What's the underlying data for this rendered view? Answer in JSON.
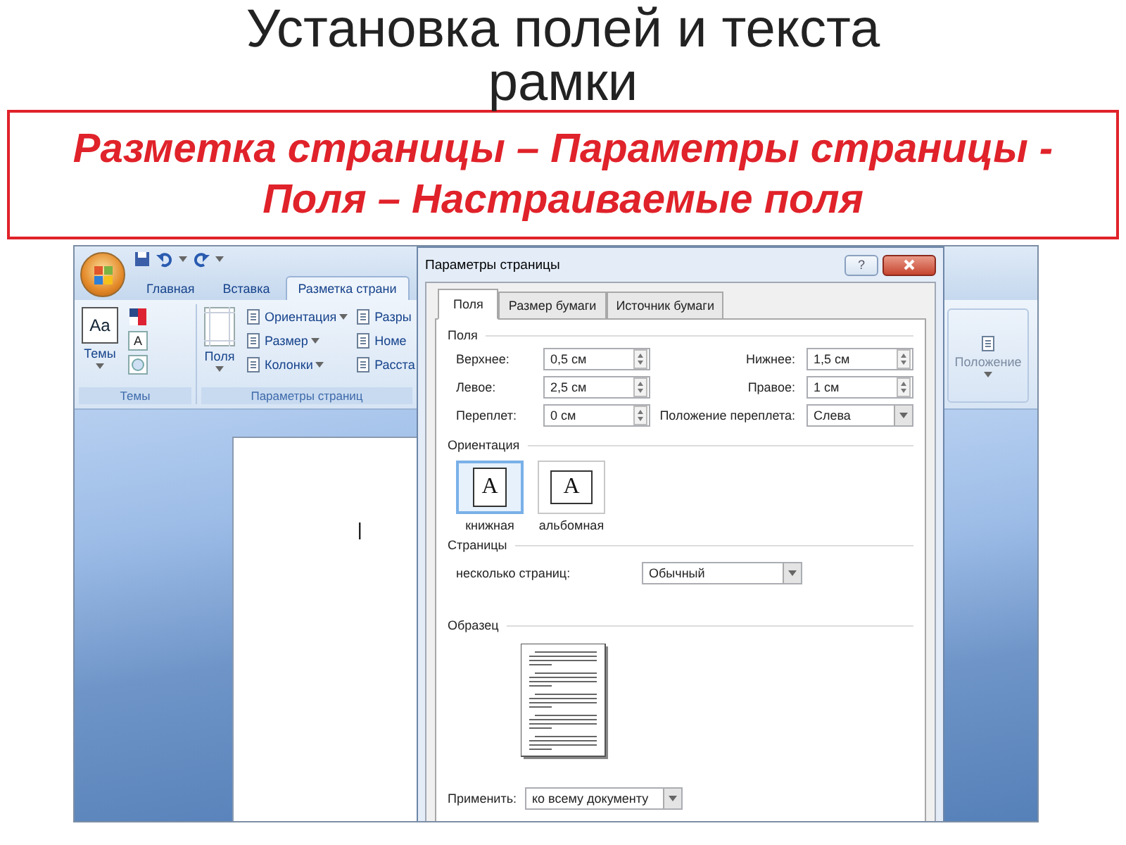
{
  "slide": {
    "title": "Установка полей и текста рамки",
    "callout": "Разметка страницы – Параметры страницы - Поля – Настраиваемые поля"
  },
  "word": {
    "tabs": [
      {
        "label": "Главная",
        "selected": false
      },
      {
        "label": "Вставка",
        "selected": false
      },
      {
        "label": "Разметка страни",
        "selected": true
      }
    ],
    "themes_group": {
      "label": "Темы",
      "button": "Темы",
      "icon_text": "Aa",
      "fonts_glyph": "A"
    },
    "page_setup_group": {
      "label": "Параметры страниц",
      "large_button": "Поля",
      "commands": [
        "Ориентация",
        "Размер",
        "Колонки"
      ],
      "commands_cut": [
        "Разры",
        "Номе",
        "Расста"
      ]
    },
    "arrange_group": {
      "button": "Положение"
    }
  },
  "dialog": {
    "title": "Параметры страницы",
    "help": "?",
    "tabs": [
      {
        "label": "Поля",
        "selected": true
      },
      {
        "label": "Размер бумаги",
        "selected": false
      },
      {
        "label": "Источник бумаги",
        "selected": false
      }
    ],
    "margins": {
      "heading": "Поля",
      "fields": [
        {
          "label": "Верхнее:",
          "value": "0,5 см"
        },
        {
          "label": "Нижнее:",
          "value": "1,5 см"
        },
        {
          "label": "Левое:",
          "value": "2,5 см"
        },
        {
          "label": "Правое:",
          "value": "1 см"
        },
        {
          "label": "Переплет:",
          "value": "0 см"
        }
      ],
      "gutter": {
        "label": "Положение переплета:",
        "value": "Слева"
      }
    },
    "orientation": {
      "heading": "Ориентация",
      "options": [
        {
          "label": "книжная",
          "glyph": "A",
          "selected": true
        },
        {
          "label": "альбомная",
          "glyph": "A",
          "selected": false
        }
      ]
    },
    "pages": {
      "heading": "Страницы",
      "label": "несколько страниц:",
      "value": "Обычный"
    },
    "preview": {
      "heading": "Образец"
    },
    "apply": {
      "label": "Применить:",
      "value": "ко всему документу"
    }
  }
}
